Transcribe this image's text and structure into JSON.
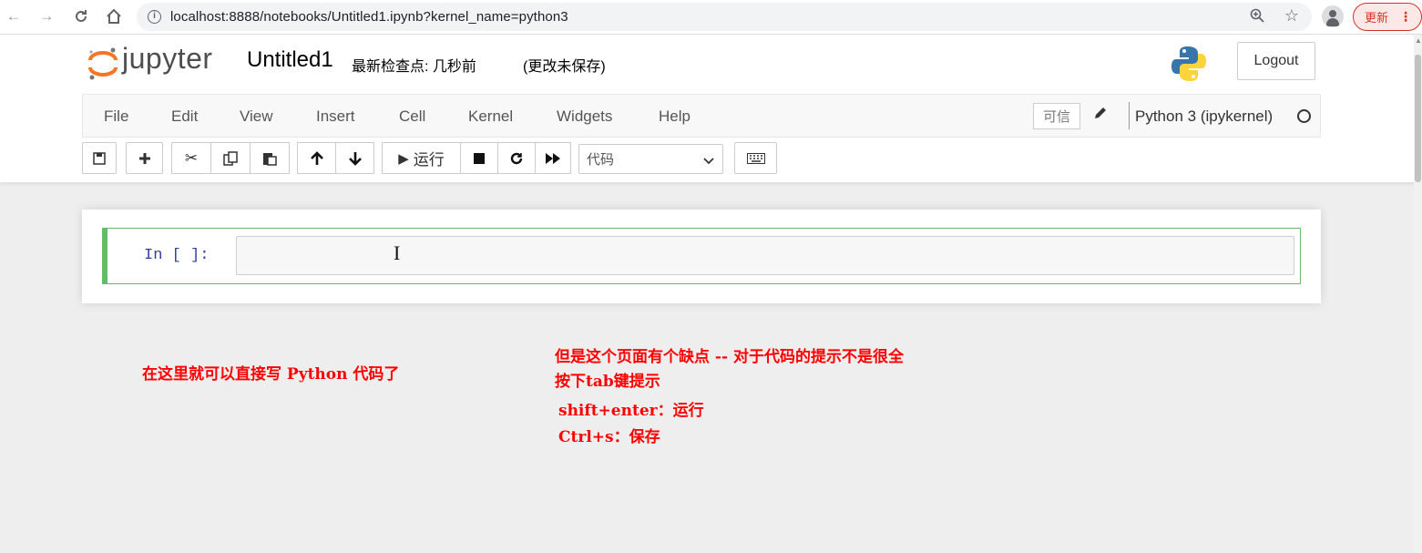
{
  "browser": {
    "url": "localhost:8888/notebooks/Untitled1.ipynb?kernel_name=python3",
    "update_label": "更新"
  },
  "header": {
    "logo_text": "jupyter",
    "notebook_title": "Untitled1",
    "checkpoint_text": "最新检查点: 几秒前",
    "autosave_text": "(更改未保存)",
    "logout_label": "Logout"
  },
  "menubar": {
    "items": [
      "File",
      "Edit",
      "View",
      "Insert",
      "Cell",
      "Kernel",
      "Widgets",
      "Help"
    ],
    "trusted_label": "可信",
    "kernel_name": "Python 3 (ipykernel)"
  },
  "toolbar": {
    "run_label": "运行",
    "cell_type": "代码"
  },
  "cell": {
    "prompt": "In [ ]:",
    "code": ""
  },
  "annotations": {
    "note_1": "在这里就可以直接写 Python 代码了",
    "note_2": "但是这个页面有个缺点 -- 对于代码的提示不是很全",
    "note_3": "按下tab键提示",
    "note_4": "shift+enter：运行",
    "note_5": "Ctrl+s：保存"
  },
  "colors": {
    "annotation": "#ff0000",
    "cell_border": "#66bb6a",
    "prompt": "#303f9f"
  }
}
